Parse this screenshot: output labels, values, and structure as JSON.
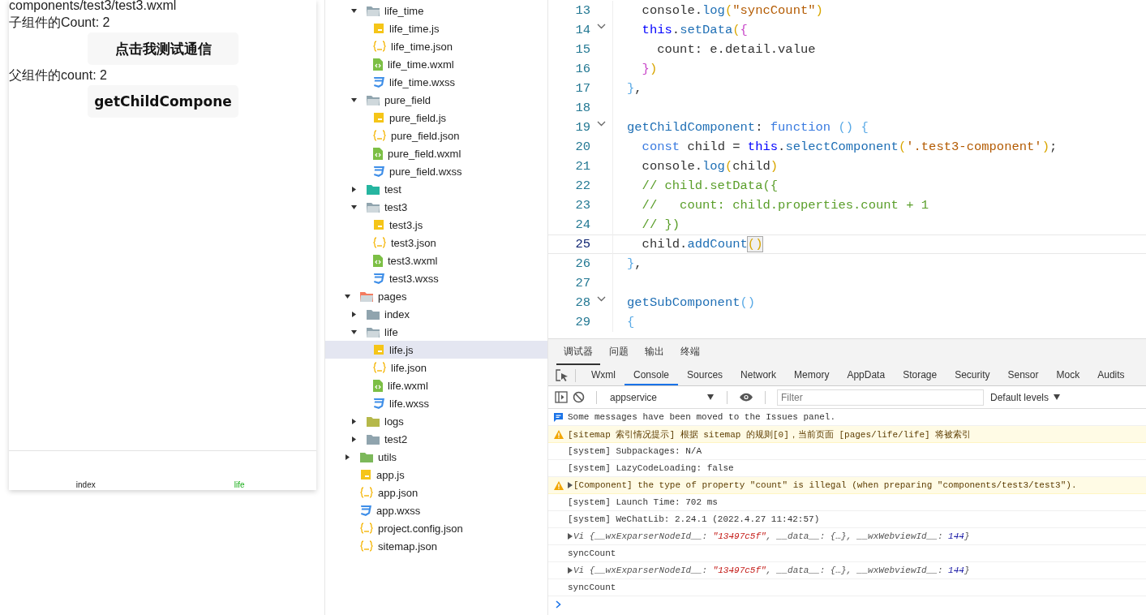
{
  "simulator": {
    "path_text": "components/test3/test3.wxml",
    "child_count": "子组件的Count: 2",
    "test_button": "点击我测试通信",
    "parent_count": "父组件的count: 2",
    "get_child_button": "getChildCompone",
    "tab_bar": [
      {
        "label": "index",
        "selected": false
      },
      {
        "label": "life",
        "selected": true
      }
    ]
  },
  "file_tree": {
    "continued_items": [
      {
        "label": "life_time",
        "kind": "folder",
        "expanded": true,
        "children": [
          {
            "label": "life_time.js",
            "kind": "js",
            "selected": false
          },
          {
            "label": "life_time.json",
            "kind": "json",
            "selected": false
          },
          {
            "label": "life_time.wxml",
            "kind": "wxml",
            "selected": false
          },
          {
            "label": "life_time.wxss",
            "kind": "wxss",
            "selected": false
          }
        ]
      },
      {
        "label": "pure_field",
        "kind": "folder",
        "expanded": true,
        "children": [
          {
            "label": "pure_field.js",
            "kind": "js",
            "selected": false
          },
          {
            "label": "pure_field.json",
            "kind": "json",
            "selected": false
          },
          {
            "label": "pure_field.wxml",
            "kind": "wxml",
            "selected": false
          },
          {
            "label": "pure_field.wxss",
            "kind": "wxss",
            "selected": false
          }
        ]
      },
      {
        "label": "test",
        "kind": "folder-teal",
        "expanded": false
      },
      {
        "label": "test3",
        "kind": "folder",
        "expanded": true,
        "children": [
          {
            "label": "test3.js",
            "kind": "js",
            "selected": false
          },
          {
            "label": "test3.json",
            "kind": "json",
            "selected": false
          },
          {
            "label": "test3.wxml",
            "kind": "wxml",
            "selected": false
          },
          {
            "label": "test3.wxss",
            "kind": "wxss",
            "selected": false
          }
        ]
      }
    ],
    "items": [
      {
        "label": "pages",
        "kind": "folder-pages",
        "expanded": true,
        "children": [
          {
            "label": "index",
            "kind": "folder",
            "expanded": false
          },
          {
            "label": "life",
            "kind": "folder",
            "expanded": true,
            "children": [
              {
                "label": "life.js",
                "kind": "js",
                "selected": true
              },
              {
                "label": "life.json",
                "kind": "json",
                "selected": false
              },
              {
                "label": "life.wxml",
                "kind": "wxml",
                "selected": false
              },
              {
                "label": "life.wxss",
                "kind": "wxss",
                "selected": false
              }
            ]
          },
          {
            "label": "logs",
            "kind": "folder-logs",
            "expanded": false
          },
          {
            "label": "test2",
            "kind": "folder",
            "expanded": false
          }
        ]
      },
      {
        "label": "utils",
        "kind": "folder-utils",
        "expanded": false
      },
      {
        "label": "app.js",
        "kind": "js",
        "selected": false
      },
      {
        "label": "app.json",
        "kind": "json",
        "selected": false
      },
      {
        "label": "app.wxss",
        "kind": "wxss",
        "selected": false
      },
      {
        "label": "project.config.json",
        "kind": "json",
        "selected": false
      },
      {
        "label": "sitemap.json",
        "kind": "json",
        "selected": false
      }
    ]
  },
  "editor": {
    "lines": [
      {
        "number": "13",
        "fold": false,
        "current": false,
        "segments": [
          {
            "text": "  console.",
            "kind": "plain"
          },
          {
            "text": "log",
            "kind": "func"
          },
          {
            "text": "(",
            "kind": "b1"
          },
          {
            "text": "\"syncCount\"",
            "kind": "string"
          },
          {
            "text": ")",
            "kind": "b1"
          }
        ]
      },
      {
        "number": "14",
        "fold": true,
        "current": false,
        "segments": [
          {
            "text": "  this",
            "kind": "keyword"
          },
          {
            "text": ".",
            "kind": "plain"
          },
          {
            "text": "setData",
            "kind": "func"
          },
          {
            "text": "(",
            "kind": "b1"
          },
          {
            "text": "{",
            "kind": "b2"
          }
        ]
      },
      {
        "number": "15",
        "fold": false,
        "current": false,
        "segments": [
          {
            "text": "    count: e.detail.value",
            "kind": "plain"
          }
        ]
      },
      {
        "number": "16",
        "fold": false,
        "current": false,
        "segments": [
          {
            "text": "  }",
            "kind": "b2"
          },
          {
            "text": ")",
            "kind": "b1"
          }
        ]
      },
      {
        "number": "17",
        "fold": false,
        "current": false,
        "segments": [
          {
            "text": "}",
            "kind": "b3"
          },
          {
            "text": ",",
            "kind": "plain"
          }
        ]
      },
      {
        "number": "18",
        "fold": false,
        "current": false
      },
      {
        "number": "19",
        "fold": true,
        "current": false,
        "segments": [
          {
            "text": "getChildComponent",
            "kind": "func"
          },
          {
            "text": ": ",
            "kind": "plain"
          },
          {
            "text": "function",
            "kind": "keyword2"
          },
          {
            "text": " ()",
            "kind": "b3"
          },
          {
            "text": " {",
            "kind": "b3"
          }
        ]
      },
      {
        "number": "20",
        "fold": false,
        "current": false,
        "segments": [
          {
            "text": "  const",
            "kind": "keyword2"
          },
          {
            "text": " child = ",
            "kind": "plain"
          },
          {
            "text": "this",
            "kind": "keyword"
          },
          {
            "text": ".",
            "kind": "plain"
          },
          {
            "text": "selectComponent",
            "kind": "func"
          },
          {
            "text": "(",
            "kind": "b1"
          },
          {
            "text": "'.test3-component'",
            "kind": "string"
          },
          {
            "text": ")",
            "kind": "b1"
          },
          {
            "text": ";",
            "kind": "plain"
          }
        ]
      },
      {
        "number": "21",
        "fold": false,
        "current": false,
        "segments": [
          {
            "text": "  console.",
            "kind": "plain"
          },
          {
            "text": "log",
            "kind": "func"
          },
          {
            "text": "(",
            "kind": "b1"
          },
          {
            "text": "child",
            "kind": "plain"
          },
          {
            "text": ")",
            "kind": "b1"
          }
        ]
      },
      {
        "number": "22",
        "fold": false,
        "current": false,
        "segments": [
          {
            "text": "  // child.setData({",
            "kind": "comment"
          }
        ]
      },
      {
        "number": "23",
        "fold": false,
        "current": false,
        "segments": [
          {
            "text": "  //   count: child.properties.count + 1",
            "kind": "comment"
          }
        ]
      },
      {
        "number": "24",
        "fold": false,
        "current": false,
        "segments": [
          {
            "text": "  // })",
            "kind": "comment"
          }
        ]
      },
      {
        "number": "25",
        "fold": false,
        "current": true,
        "segments": [
          {
            "text": "  child.",
            "kind": "plain"
          },
          {
            "text": "addCount",
            "kind": "func"
          },
          {
            "text": "()",
            "kind": "match"
          }
        ]
      },
      {
        "number": "26",
        "fold": false,
        "current": false,
        "segments": [
          {
            "text": "}",
            "kind": "b3"
          },
          {
            "text": ",",
            "kind": "plain"
          }
        ]
      },
      {
        "number": "27",
        "fold": false,
        "current": false
      },
      {
        "number": "28",
        "fold": true,
        "current": false,
        "segments": [
          {
            "text": "getSubComponent",
            "kind": "func"
          },
          {
            "text": "()",
            "kind": "b3"
          }
        ]
      },
      {
        "number": "29",
        "fold": false,
        "current": false,
        "segments": [
          {
            "text": "{",
            "kind": "b3"
          }
        ]
      }
    ]
  },
  "devtools": {
    "panel_tabs": [
      {
        "label": "调试器",
        "selected": true
      },
      {
        "label": "问题",
        "selected": false
      },
      {
        "label": "输出",
        "selected": false
      },
      {
        "label": "终端",
        "selected": false
      }
    ],
    "tool_tabs": [
      {
        "label": "Wxml",
        "selected": false
      },
      {
        "label": "Console",
        "selected": true
      },
      {
        "label": "Sources",
        "selected": false
      },
      {
        "label": "Network",
        "selected": false
      },
      {
        "label": "Memory",
        "selected": false
      },
      {
        "label": "AppData",
        "selected": false
      },
      {
        "label": "Storage",
        "selected": false
      },
      {
        "label": "Security",
        "selected": false
      },
      {
        "label": "Sensor",
        "selected": false
      },
      {
        "label": "Mock",
        "selected": false
      },
      {
        "label": "Audits",
        "selected": false
      }
    ],
    "context": "appservice",
    "filter_placeholder": "Filter",
    "levels": "Default levels",
    "messages": [
      {
        "kind": "info",
        "expandable": false,
        "segments": [
          {
            "text": "Some messages have been moved to the Issues panel.",
            "kind": "plain"
          }
        ]
      },
      {
        "kind": "warning",
        "expandable": false,
        "segments": [
          {
            "text": "[sitemap 索引情况提示] 根据 sitemap 的规则[0]，当前页面 [pages/life/life] 将被索引",
            "kind": "plain"
          }
        ]
      },
      {
        "kind": "log",
        "expandable": false,
        "segments": [
          {
            "text": "[system] Subpackages: N/A",
            "kind": "plain"
          }
        ]
      },
      {
        "kind": "log",
        "expandable": false,
        "segments": [
          {
            "text": "[system] LazyCodeLoading: false",
            "kind": "plain"
          }
        ]
      },
      {
        "kind": "warning",
        "expandable": true,
        "segments": [
          {
            "text": "[Component] the type of property \"count\" is illegal (when preparing \"components/test3/test3\").",
            "kind": "plain"
          }
        ]
      },
      {
        "kind": "log",
        "expandable": false,
        "segments": [
          {
            "text": "[system] Launch Time: 702 ms",
            "kind": "plain"
          }
        ]
      },
      {
        "kind": "log",
        "expandable": false,
        "segments": [
          {
            "text": "[system] WeChatLib: 2.24.1 (2022.4.27 11:42:57)",
            "kind": "plain"
          }
        ]
      },
      {
        "kind": "log",
        "expandable": true,
        "segments": [
          {
            "text": "Vi {__wxExparserNodeId__: ",
            "kind": "italic"
          },
          {
            "text": "\"13497c5f\"",
            "kind": "string"
          },
          {
            "text": ", __data__: {…}, __wxWebviewId__: ",
            "kind": "italic"
          },
          {
            "text": "144",
            "kind": "number"
          },
          {
            "text": "}",
            "kind": "italic"
          }
        ]
      },
      {
        "kind": "log",
        "expandable": false,
        "segments": [
          {
            "text": "syncCount",
            "kind": "plain"
          }
        ]
      },
      {
        "kind": "log",
        "expandable": true,
        "segments": [
          {
            "text": "Vi {__wxExparserNodeId__: ",
            "kind": "italic"
          },
          {
            "text": "\"13497c5f\"",
            "kind": "string"
          },
          {
            "text": ", __data__: {…}, __wxWebviewId__: ",
            "kind": "italic"
          },
          {
            "text": "144",
            "kind": "number"
          },
          {
            "text": "}",
            "kind": "italic"
          }
        ]
      },
      {
        "kind": "log",
        "expandable": false,
        "segments": [
          {
            "text": "syncCount",
            "kind": "plain"
          }
        ]
      }
    ]
  }
}
